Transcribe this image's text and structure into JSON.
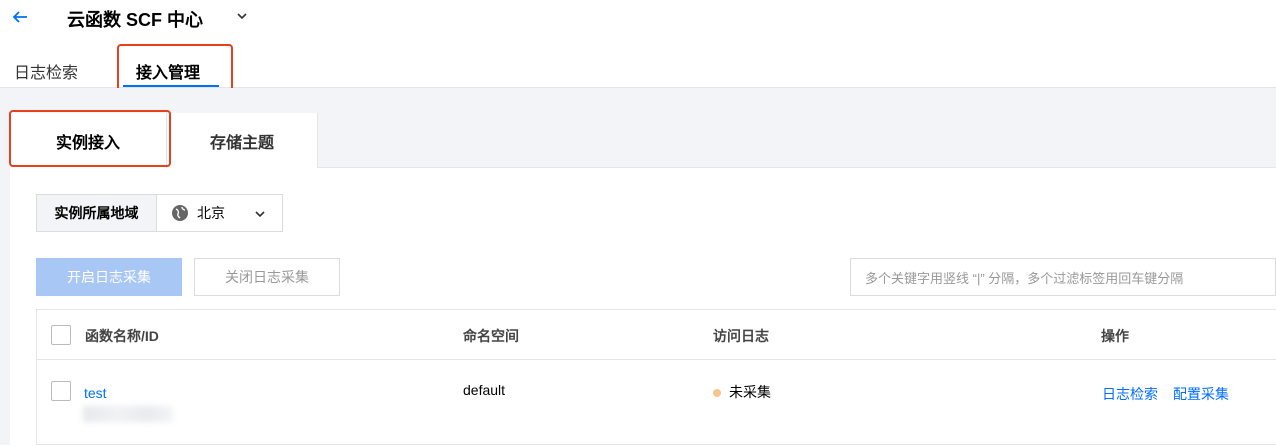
{
  "header": {
    "back_icon": "arrow-left-icon",
    "title": "云函数 SCF 中心",
    "dropdown_icon": "chevron-down-icon"
  },
  "tabs": [
    {
      "label": "日志检索",
      "active": false
    },
    {
      "label": "接入管理",
      "active": true
    }
  ],
  "subtabs": [
    {
      "label": "实例接入",
      "active": true
    },
    {
      "label": "存储主题",
      "active": false
    }
  ],
  "region": {
    "label": "实例所属地域",
    "value": "北京",
    "icon": "globe-icon"
  },
  "toolbar": {
    "enable_label": "开启日志采集",
    "disable_label": "关闭日志采集",
    "search_placeholder": "多个关键字用竖线 “|” 分隔，多个过滤标签用回车键分隔"
  },
  "table": {
    "columns": [
      "函数名称/ID",
      "命名空间",
      "访问日志",
      "操作"
    ],
    "rows": [
      {
        "name": "test",
        "namespace": "default",
        "status": "未采集",
        "actions": [
          "日志检索",
          "配置采集"
        ]
      }
    ]
  },
  "colors": {
    "accent": "#006eff",
    "highlight": "#e5411d",
    "status_pending": "#f6c68e"
  }
}
